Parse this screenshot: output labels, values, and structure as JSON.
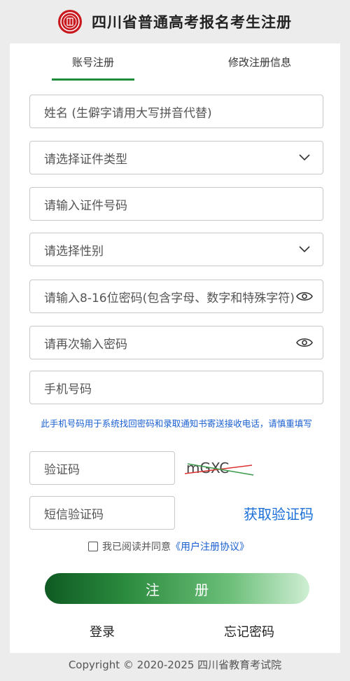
{
  "header": {
    "title": "四川省普通高考报名考生注册",
    "logo_icon": "seal-logo-icon",
    "logo_color": "#c8191f"
  },
  "tabs": {
    "account": "账号注册",
    "modify": "修改注册信息",
    "active_color": "#1e8c3a"
  },
  "form": {
    "name_placeholder": "姓名 (生僻字请用大写拼音代替)",
    "id_type_placeholder": "请选择证件类型",
    "id_number_placeholder": "请输入证件号码",
    "gender_placeholder": "请选择性别",
    "password_placeholder": "请输入8-16位密码(包含字母、数字和特殊字符)",
    "confirm_password_placeholder": "请再次输入密码",
    "phone_placeholder": "手机号码",
    "phone_notice": "此手机号码用于系统找回密码和录取通知书寄送接收电话，请慎重填写",
    "captcha_placeholder": "验证码",
    "captcha_text": "mGXC",
    "sms_code_placeholder": "短信验证码",
    "get_code_link": "获取验证码"
  },
  "agreement": {
    "prefix": "我已阅读并同意",
    "link": "《用户注册协议》"
  },
  "buttons": {
    "register": "注 册",
    "login": "登录",
    "forgot": "忘记密码"
  },
  "footer": {
    "copyright": "Copyright © 2020-2025 四川省教育考试院"
  },
  "colors": {
    "link_blue": "#1a5fd1",
    "button_green_dark": "#0f5a23",
    "button_green_light": "#cfeed3"
  }
}
